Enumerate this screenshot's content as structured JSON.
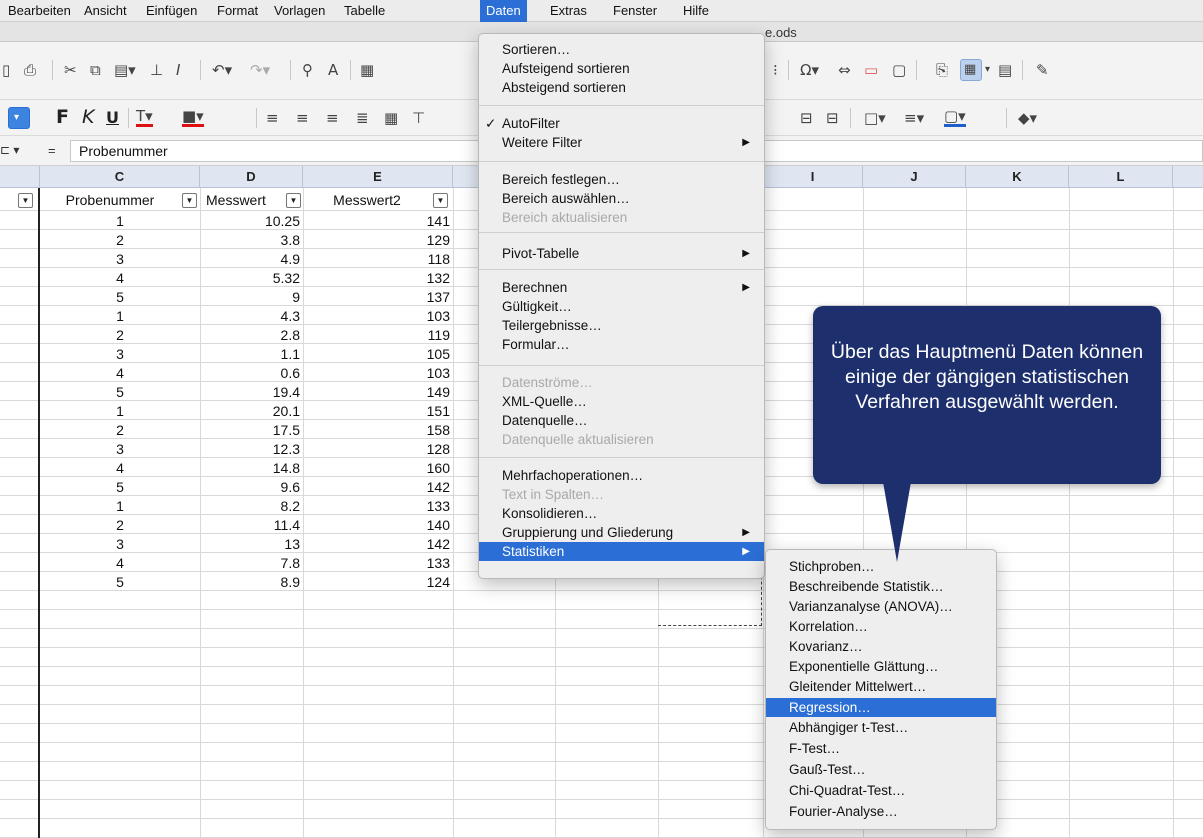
{
  "menubar": {
    "items": [
      "Bearbeiten",
      "Ansicht",
      "Einfügen",
      "Format",
      "Vorlagen",
      "Tabelle",
      "Daten",
      "Extras",
      "Fenster",
      "Hilfe"
    ]
  },
  "titlebar": {
    "doc_title": "e.ods"
  },
  "formula_bar": {
    "eq": "=",
    "content": "Probenummer"
  },
  "sheet": {
    "columns": [
      "C",
      "D",
      "E",
      "I",
      "J",
      "K",
      "L"
    ],
    "headers": {
      "c": "Probenummer",
      "d": "Messwert",
      "e": "Messwert2"
    },
    "rows": [
      [
        "1",
        "10.25",
        "141"
      ],
      [
        "2",
        "3.8",
        "129"
      ],
      [
        "3",
        "4.9",
        "118"
      ],
      [
        "4",
        "5.32",
        "132"
      ],
      [
        "5",
        "9",
        "137"
      ],
      [
        "1",
        "4.3",
        "103"
      ],
      [
        "2",
        "2.8",
        "119"
      ],
      [
        "3",
        "1.1",
        "105"
      ],
      [
        "4",
        "0.6",
        "103"
      ],
      [
        "5",
        "19.4",
        "149"
      ],
      [
        "1",
        "20.1",
        "151"
      ],
      [
        "2",
        "17.5",
        "158"
      ],
      [
        "3",
        "12.3",
        "128"
      ],
      [
        "4",
        "14.8",
        "160"
      ],
      [
        "5",
        "9.6",
        "142"
      ],
      [
        "1",
        "8.2",
        "133"
      ],
      [
        "2",
        "11.4",
        "140"
      ],
      [
        "3",
        "13",
        "142"
      ],
      [
        "4",
        "7.8",
        "133"
      ],
      [
        "5",
        "8.9",
        "124"
      ]
    ]
  },
  "daten_menu": {
    "items": [
      "Sortieren…",
      "Aufsteigend sortieren",
      "Absteigend sortieren",
      "AutoFilter",
      "Weitere Filter",
      "Bereich festlegen…",
      "Bereich auswählen…",
      "Bereich aktualisieren",
      "Pivot-Tabelle",
      "Berechnen",
      "Gültigkeit…",
      "Teilergebnisse…",
      "Formular…",
      "Datenströme…",
      "XML-Quelle…",
      "Datenquelle…",
      "Datenquelle aktualisieren",
      "Mehrfachoperationen…",
      "Text in Spalten…",
      "Konsolidieren…",
      "Gruppierung und Gliederung",
      "Statistiken"
    ],
    "check": "✓"
  },
  "statistik_menu": {
    "items": [
      "Stichproben…",
      "Beschreibende Statistik…",
      "Varianzanalyse (ANOVA)…",
      "Korrelation…",
      "Kovarianz…",
      "Exponentielle Glättung…",
      "Gleitender Mittelwert…",
      "Regression…",
      "Abhängiger t-Test…",
      "F-Test…",
      "Gauß-Test…",
      "Chi-Quadrat-Test…",
      "Fourier-Analyse…"
    ]
  },
  "callout": {
    "text": "Über das Hauptmenü Daten können einige der gängigen statistischen Verfahren ausgewählt werden."
  },
  "colors": {
    "accent": "#2b6fd6",
    "callout_bg": "#1e2f6e",
    "col_header_bg": "#dfe6f2"
  }
}
